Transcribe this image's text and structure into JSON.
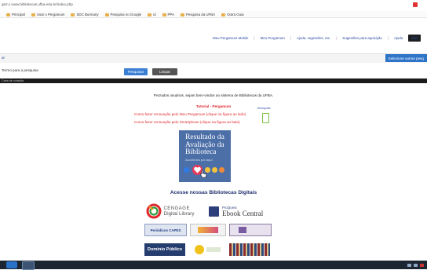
{
  "browser": {
    "address": "gsm | www.bibliotecas.ufba.edu.br/index.php",
    "bookmarks": [
      "Principal",
      "Usar o Pergamum",
      "SDC Burmany",
      "Pesquisa no Google",
      "ul",
      "PPA",
      "Pesquisa da UFBA",
      "Outra Guia"
    ]
  },
  "header": {
    "links": [
      "Meu Pergamum Mobile",
      "Meu Pergamum",
      "Ajuda, sugestões, etc.",
      "Sugestões para aquisição",
      "Ajuda"
    ],
    "action_button": "Sair"
  },
  "band": {
    "left_text": "al",
    "select_button": "Selecione outras pesq"
  },
  "search": {
    "label": "Termo para a pesquisa",
    "search_button": "Pesquisar",
    "clear_button": "Limpar"
  },
  "black_band_text": "Carta de consulta",
  "main": {
    "welcome": "Prezados usuários, sejam bem-vindos ao sistema de Bibliotecas da UFBA.",
    "tutorial_title": "Tutorial - Pergamum",
    "tutorial_line1": "Como fazer renovação pelo Meu Pergamum (clique na figura ao lado)",
    "tutorial_line2": "Como fazer renovação pelo Smartphone (clique na figura ao lado)",
    "phone_label": "Ibertopolis",
    "eval_title": "Resultado da Avaliação da Biblioteca",
    "eval_subtitle": "Aconteceu por aqui",
    "digital_title": "Acesse nossas Bibliotecas Digitais",
    "logos": {
      "cengage": "CENGAGE",
      "cengage_sub": "Digital Library",
      "proquest": "ProQuest",
      "ebook_central": "Ebook Central",
      "capes": "Periódicos CAPES",
      "dominio": "Domínio Público"
    }
  },
  "colors": {
    "accent": "#3b7fd4",
    "red": "#e0272b",
    "eval_card": "#4c6fa8",
    "taskbar": "#1c2532"
  }
}
